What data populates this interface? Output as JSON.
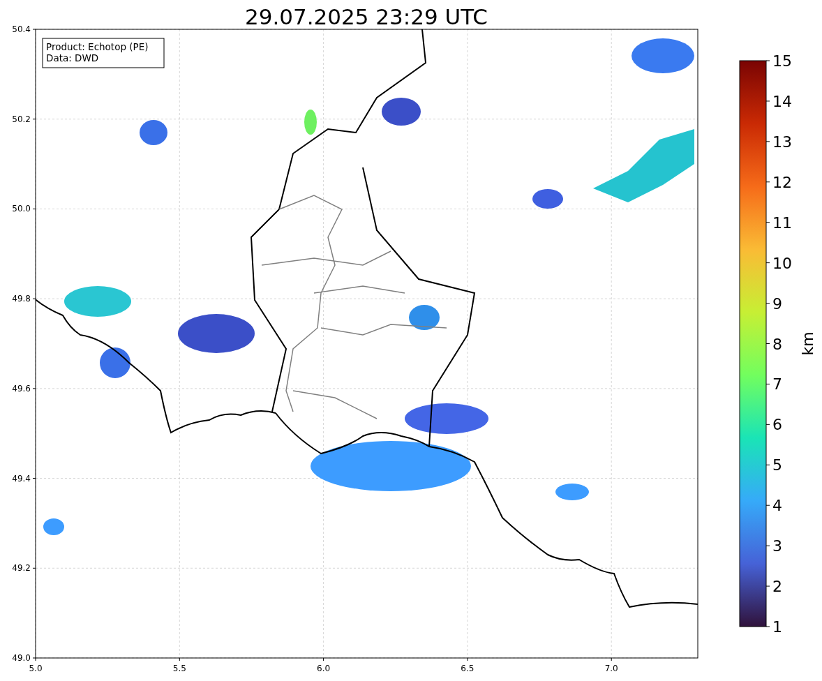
{
  "title": "29.07.2025 23:29 UTC",
  "map": {
    "legend": [
      "Product: Echotop (PE)",
      "Data: DWD"
    ],
    "x_tick_labels": [
      "5.0",
      "5.5",
      "6.0",
      "6.5",
      "7.0"
    ],
    "y_tick_labels": [
      "50.4",
      "50.2",
      "50.0",
      "49.8",
      "49.6",
      "49.4",
      "49.2",
      "49.0"
    ]
  },
  "colorbar": {
    "label": "km",
    "tick_labels": [
      "15",
      "14",
      "13",
      "12",
      "11",
      "10",
      "9",
      "8",
      "7",
      "6",
      "5",
      "4",
      "3",
      "2",
      "1"
    ]
  }
}
